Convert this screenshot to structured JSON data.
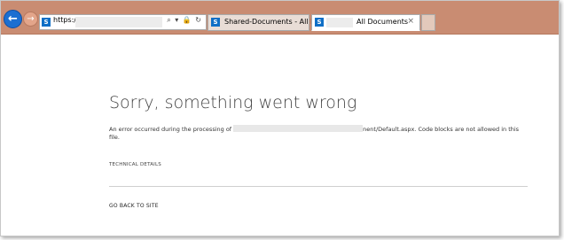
{
  "browser": {
    "address": {
      "protocol_text": "https:/",
      "tools": "⌕ ▾ 🔒 ↻"
    },
    "tabs": [
      {
        "label": "Shared-Documents - All Docu..."
      },
      {
        "label": "All Documents",
        "close": "×"
      }
    ],
    "icons": {
      "back": "back-arrow-icon",
      "forward": "forward-arrow-icon",
      "site": "sharepoint-icon"
    },
    "colors": {
      "toolbar": "#c98c72",
      "back_button": "#1c6fd1"
    }
  },
  "error_page": {
    "title": "Sorry, something went wrong",
    "message_prefix": "An error occurred during the processing of",
    "message_suffix": "nent/Default.aspx. Code blocks are not allowed in this file.",
    "technical_details": "TECHNICAL DETAILS",
    "go_back": "GO BACK TO SITE"
  }
}
